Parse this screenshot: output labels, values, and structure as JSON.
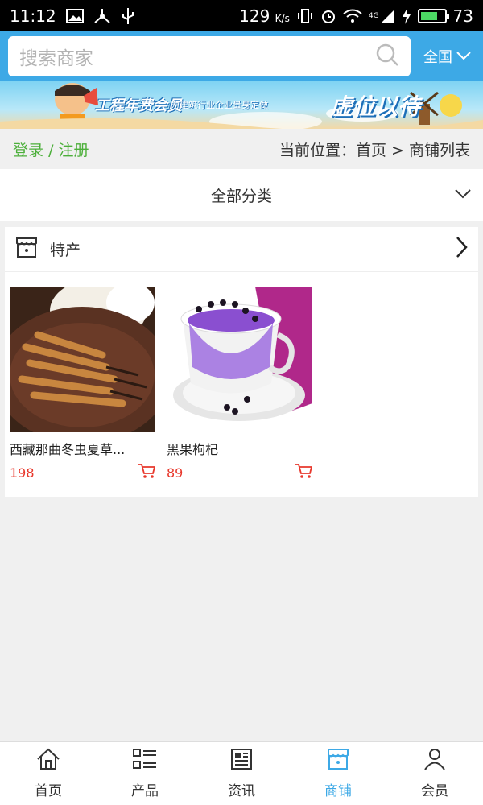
{
  "status_bar": {
    "time": "11:12",
    "net_speed": "129",
    "net_unit": "K/s",
    "network": "4G",
    "battery": "73",
    "battery_level": 0.73
  },
  "search": {
    "placeholder": "搜索商家",
    "region_label": "全国"
  },
  "banner": {
    "headline": "工程年费会员",
    "subline": "为建筑行业企业量身定做",
    "slogan": "虚位以待"
  },
  "breadcrumb": {
    "login": "登录",
    "separator": "/",
    "register": "注册",
    "position_label": "当前位置：",
    "home": "首页",
    "arrow": ">",
    "current": "商铺列表"
  },
  "category": {
    "label": "全部分类"
  },
  "shop": {
    "name": "特产",
    "products": [
      {
        "name": "西藏那曲冬虫夏草...",
        "price": "198"
      },
      {
        "name": "黑果枸杞",
        "price": "89"
      }
    ]
  },
  "bottom_nav": {
    "items": [
      {
        "label": "首页",
        "icon": "home-icon"
      },
      {
        "label": "产品",
        "icon": "list-icon"
      },
      {
        "label": "资讯",
        "icon": "news-icon"
      },
      {
        "label": "商铺",
        "icon": "shop-icon"
      },
      {
        "label": "会员",
        "icon": "user-icon"
      }
    ],
    "active_index": 3
  },
  "colors": {
    "header_blue": "#3da9e6",
    "login_green": "#4caf3a",
    "price_red": "#e8382c",
    "active_tab": "#3da9e6"
  }
}
